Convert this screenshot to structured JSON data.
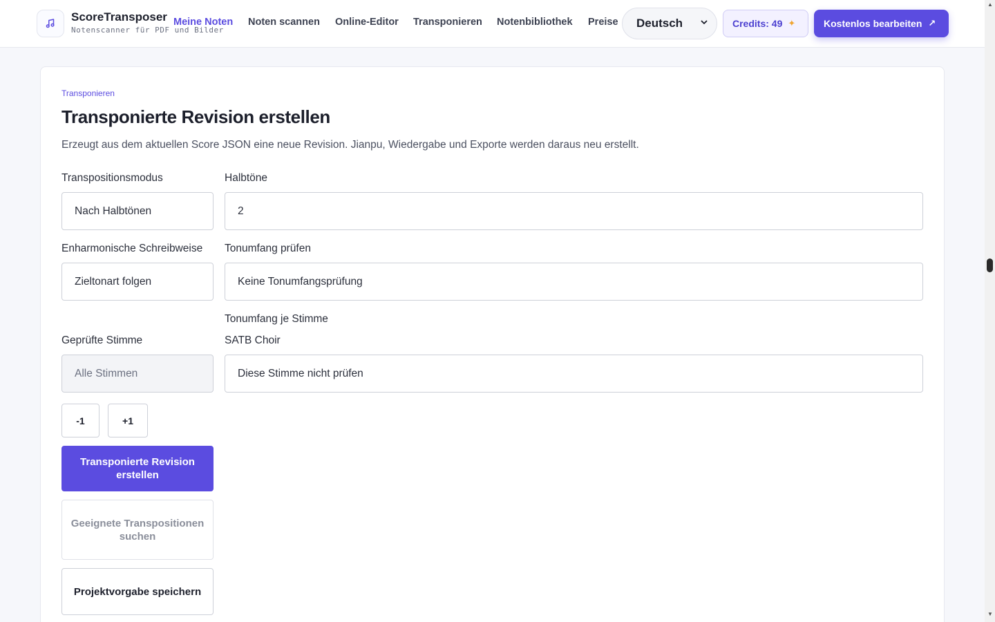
{
  "header": {
    "brand_name": "ScoreTransposer",
    "brand_tagline": "Notenscanner für PDF und Bilder",
    "nav": [
      {
        "label": "Meine Noten",
        "active": true
      },
      {
        "label": "Noten scannen",
        "active": false
      },
      {
        "label": "Online-Editor",
        "active": false
      },
      {
        "label": "Transponieren",
        "active": false
      },
      {
        "label": "Notenbibliothek",
        "active": false
      },
      {
        "label": "Preise",
        "active": false
      }
    ],
    "language": "Deutsch",
    "credits_label": "Credits: 49",
    "cta_label": "Kostenlos bearbeiten",
    "icons": {
      "logo": "music-note-icon",
      "credits": "sparkle-icon",
      "cta": "external-arrow-icon",
      "language": "chevron-down-icon"
    }
  },
  "section": {
    "eyebrow": "Transponieren",
    "title": "Transponierte Revision erstellen",
    "description": "Erzeugt aus dem aktuellen Score JSON eine neue Revision. Jianpu, Wiedergabe und Exporte werden daraus neu erstellt."
  },
  "form": {
    "mode_label": "Transpositionsmodus",
    "mode_value": "Nach Halbtönen",
    "semitones_label": "Halbtöne",
    "semitones_value": "2",
    "enharmonic_label": "Enharmonische Schreibweise",
    "enharmonic_value": "Zieltonart folgen",
    "range_check_label": "Tonumfang prüfen",
    "range_check_value": "Keine Tonumfangsprüfung",
    "range_per_voice_label": "Tonumfang je Stimme",
    "checked_voice_label": "Geprüfte Stimme",
    "checked_voice_value": "Alle Stimmen",
    "voice_group_label": "SATB Choir",
    "voice_group_value": "Diese Stimme nicht prüfen",
    "minus_label": "-1",
    "plus_label": "+1",
    "create_button": "Transponierte Revision erstellen",
    "suggest_button": "Geeignete Transpositionen suchen",
    "save_preset_button": "Projektvorgabe speichern"
  },
  "colors": {
    "accent": "#5b4ce0",
    "spark": "#f0a531"
  }
}
